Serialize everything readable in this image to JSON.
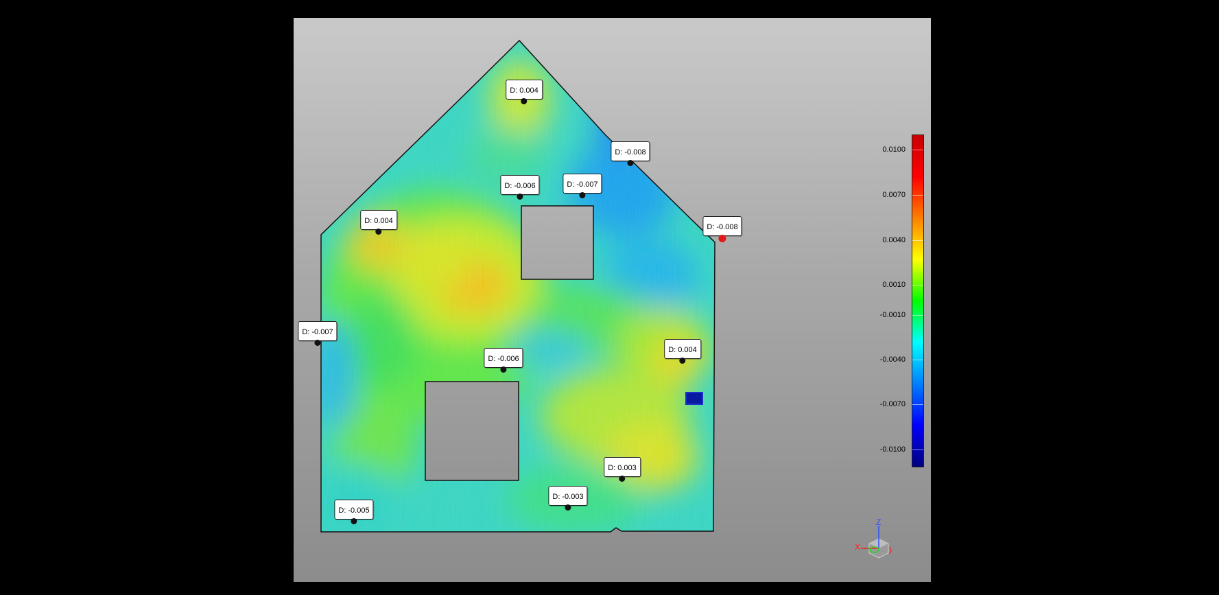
{
  "callout_prefix": "D:",
  "callouts": [
    {
      "id": "c1",
      "value": "0.004"
    },
    {
      "id": "c2",
      "value": "-0.008"
    },
    {
      "id": "c3",
      "value": "-0.006"
    },
    {
      "id": "c4",
      "value": "-0.007"
    },
    {
      "id": "c5",
      "value": "0.004"
    },
    {
      "id": "c6",
      "value": "-0.008",
      "marker": "red"
    },
    {
      "id": "c7",
      "value": "-0.007"
    },
    {
      "id": "c8",
      "value": "-0.006"
    },
    {
      "id": "c9",
      "value": "0.004"
    },
    {
      "id": "c10",
      "value": "0.003"
    },
    {
      "id": "c11",
      "value": "-0.003"
    },
    {
      "id": "c12",
      "value": "-0.005"
    }
  ],
  "color_scale": {
    "max": 0.01,
    "min": -0.01,
    "labels": [
      "0.0100",
      "0.0070",
      "0.0040",
      "0.0010",
      "-0.0010",
      "-0.0040",
      "-0.0070",
      "-0.0100"
    ],
    "colors": [
      "#00007f",
      "#0000ff",
      "#007fff",
      "#00ffff",
      "#00ff00",
      "#ffff00",
      "#ff7f00",
      "#ff0000",
      "#c80000"
    ]
  },
  "axes": {
    "x": "X",
    "y": "Y",
    "z": "Z",
    "x_color": "#ff2020",
    "y_color": "#30d030",
    "z_color": "#3050ff"
  }
}
